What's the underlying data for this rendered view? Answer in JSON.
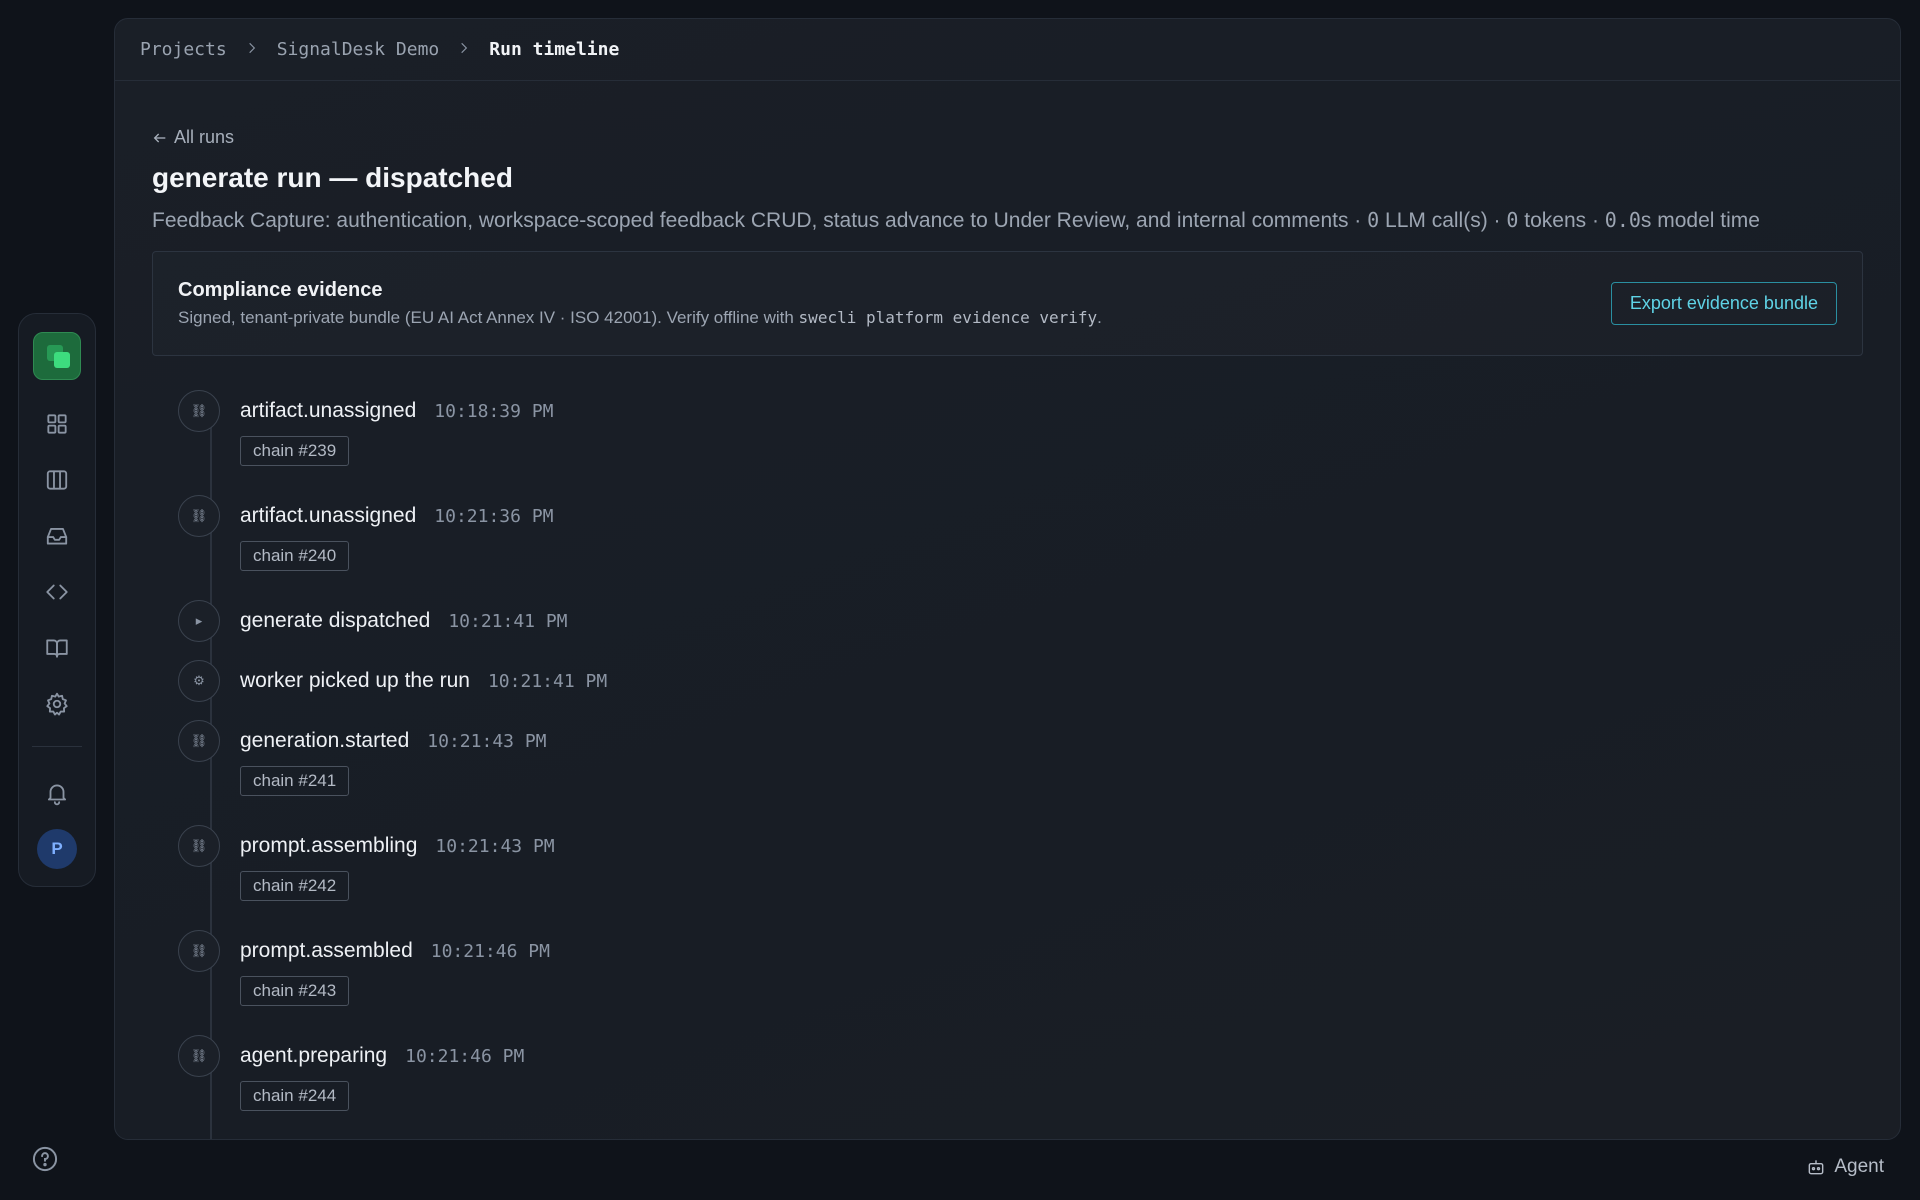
{
  "breadcrumb": {
    "items": [
      "Projects",
      "SignalDesk Demo"
    ],
    "current": "Run timeline"
  },
  "page": {
    "back_label": "All runs",
    "title": "generate run — dispatched",
    "subtitle_prefix": "Feedback Capture: authentication, workspace-scoped feedback CRUD, status advance to Under Review, and internal comments · ",
    "llm_calls": "0",
    "llm_calls_label": " LLM call(s) · ",
    "tokens": "0",
    "tokens_label": " tokens · ",
    "model_time": "0.0",
    "model_time_label": "s model time"
  },
  "evidence": {
    "title": "Compliance evidence",
    "desc_prefix": "Signed, tenant-private bundle (EU AI Act Annex IV · ISO 42001). Verify offline with ",
    "command": "swecli platform evidence verify",
    "desc_suffix": ".",
    "export_label": "Export evidence bundle"
  },
  "timeline": [
    {
      "icon": "⛓",
      "label": "artifact.unassigned",
      "time": "10:18:39 PM",
      "chain": "chain #239"
    },
    {
      "icon": "⛓",
      "label": "artifact.unassigned",
      "time": "10:21:36 PM",
      "chain": "chain #240"
    },
    {
      "icon": "▸",
      "label": "generate dispatched",
      "time": "10:21:41 PM",
      "chain": ""
    },
    {
      "icon": "⚙",
      "label": "worker picked up the run",
      "time": "10:21:41 PM",
      "chain": ""
    },
    {
      "icon": "⛓",
      "label": "generation.started",
      "time": "10:21:43 PM",
      "chain": "chain #241"
    },
    {
      "icon": "⛓",
      "label": "prompt.assembling",
      "time": "10:21:43 PM",
      "chain": "chain #242"
    },
    {
      "icon": "⛓",
      "label": "prompt.assembled",
      "time": "10:21:46 PM",
      "chain": "chain #243"
    },
    {
      "icon": "⛓",
      "label": "agent.preparing",
      "time": "10:21:46 PM",
      "chain": "chain #244"
    }
  ],
  "rail": {
    "avatar_initial": "P",
    "icons": [
      "dashboard-icon",
      "board-icon",
      "inbox-icon",
      "code-icon",
      "docs-icon",
      "settings-icon",
      "bell-icon"
    ]
  },
  "agent_label": "Agent",
  "colors": {
    "accent": "#5fd3e6",
    "brand": "#3ddc7e",
    "background": "#0f131a"
  }
}
